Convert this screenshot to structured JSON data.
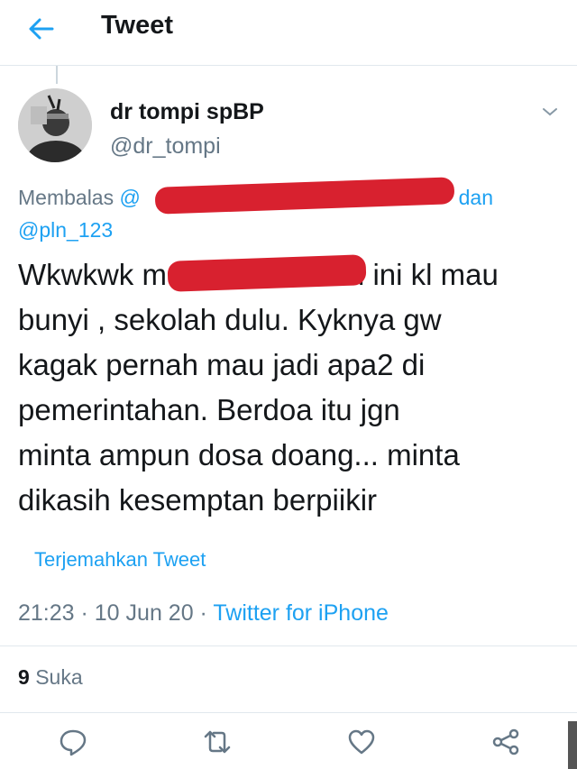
{
  "header": {
    "title": "Tweet",
    "back_icon": "arrow-left-icon"
  },
  "author": {
    "display_name": "dr tompi spBP",
    "username": "@dr_tompi"
  },
  "reply": {
    "prefix": "Membalas",
    "first_mention_visible_start": "@",
    "conjunction": "dan",
    "second_mention": "@pln_123"
  },
  "tweet": {
    "line1_start": "Wkwkwk m",
    "line1_end": "i ini kl mau",
    "rest": "bunyi , sekolah dulu. Kyknya gw\nkagak pernah mau jadi apa2 di\npemerintahan. Berdoa itu jgn\nminta ampun dosa doang... minta\ndikasih kesemptan berpiikir"
  },
  "translate_label": "Terjemahkan Tweet",
  "meta": {
    "time": "21:23",
    "date": "10 Jun 20",
    "source": "Twitter for iPhone",
    "sep": " · "
  },
  "stats": {
    "likes_count": "9",
    "likes_label": "Suka"
  },
  "colors": {
    "accent": "#1da1f2",
    "muted": "#657786",
    "text": "#14171a",
    "redaction": "#d8212f"
  },
  "actions": [
    "reply-icon",
    "retweet-icon",
    "like-icon",
    "share-icon"
  ]
}
